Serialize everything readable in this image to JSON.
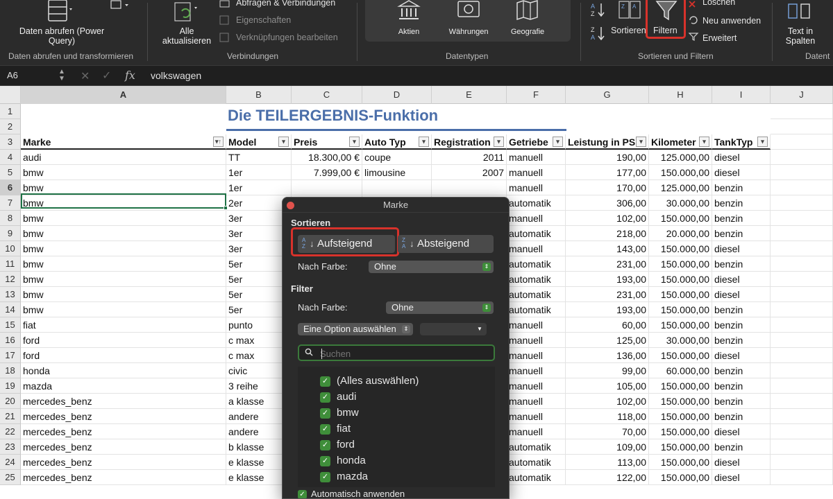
{
  "ribbon": {
    "groups": {
      "data_get": {
        "label": "Daten abrufen und transformieren",
        "button": "Daten abrufen (Power Query)"
      },
      "connections": {
        "label": "Verbindungen",
        "refresh_all": "Alle aktualisieren",
        "queries": "Abfragen & Verbindungen",
        "properties": "Eigenschaften",
        "edit_links": "Verknüpfungen bearbeiten"
      },
      "datatypes": {
        "label": "Datentypen",
        "items": [
          "Aktien",
          "Währungen",
          "Geografie"
        ]
      },
      "sort_filter": {
        "label": "Sortieren und Filtern",
        "sort": "Sortieren",
        "filter": "Filtern",
        "clear": "Löschen",
        "reapply": "Neu anwenden",
        "advanced": "Erweitert"
      },
      "data_tools": {
        "label": "Datent",
        "text_to_columns": "Text in Spalten"
      }
    }
  },
  "formula_bar": {
    "name_box": "A6",
    "value": "volkswagen",
    "fx": "fx"
  },
  "grid": {
    "columns": [
      "A",
      "B",
      "C",
      "D",
      "E",
      "F",
      "G",
      "H",
      "I",
      "J"
    ],
    "selected_column": "A",
    "selected_row": "6",
    "row_numbers": [
      "1",
      "2",
      "3",
      "4",
      "5",
      "6",
      "7",
      "8",
      "9",
      "10",
      "11",
      "12",
      "13",
      "14",
      "15",
      "16",
      "17",
      "18",
      "19",
      "20",
      "21",
      "22",
      "23",
      "24",
      "25"
    ],
    "title": "Die TEILERGEBNIS-Funktion",
    "headers": [
      "Marke",
      "Model",
      "Preis",
      "Auto Typ",
      "Registration",
      "Getriebe",
      "Leistung in PS",
      "Kilometer",
      "TankTyp"
    ],
    "rows": [
      [
        "audi",
        "TT",
        "18.300,00 €",
        "coupe",
        "2011",
        "manuell",
        "190,00",
        "125.000,00",
        "diesel"
      ],
      [
        "bmw",
        "1er",
        "7.999,00 €",
        "limousine",
        "2007",
        "manuell",
        "177,00",
        "150.000,00",
        "diesel"
      ],
      [
        "bmw",
        "1er",
        "",
        "",
        "",
        "manuell",
        "170,00",
        "125.000,00",
        "benzin"
      ],
      [
        "bmw",
        "2er",
        "",
        "",
        "",
        "automatik",
        "306,00",
        "30.000,00",
        "benzin"
      ],
      [
        "bmw",
        "3er",
        "",
        "",
        "",
        "manuell",
        "102,00",
        "150.000,00",
        "benzin"
      ],
      [
        "bmw",
        "3er",
        "",
        "",
        "",
        "automatik",
        "218,00",
        "20.000,00",
        "benzin"
      ],
      [
        "bmw",
        "3er",
        "",
        "",
        "",
        "manuell",
        "143,00",
        "150.000,00",
        "diesel"
      ],
      [
        "bmw",
        "5er",
        "",
        "",
        "",
        "automatik",
        "231,00",
        "150.000,00",
        "benzin"
      ],
      [
        "bmw",
        "5er",
        "",
        "",
        "",
        "automatik",
        "193,00",
        "150.000,00",
        "diesel"
      ],
      [
        "bmw",
        "5er",
        "",
        "",
        "",
        "automatik",
        "231,00",
        "150.000,00",
        "diesel"
      ],
      [
        "bmw",
        "5er",
        "",
        "",
        "",
        "automatik",
        "193,00",
        "150.000,00",
        "benzin"
      ],
      [
        "fiat",
        "punto",
        "",
        "",
        "",
        "manuell",
        "60,00",
        "150.000,00",
        "benzin"
      ],
      [
        "ford",
        "c max",
        "",
        "",
        "",
        "manuell",
        "125,00",
        "30.000,00",
        "benzin"
      ],
      [
        "ford",
        "c max",
        "",
        "",
        "",
        "manuell",
        "136,00",
        "150.000,00",
        "diesel"
      ],
      [
        "honda",
        "civic",
        "",
        "",
        "",
        "manuell",
        "99,00",
        "60.000,00",
        "benzin"
      ],
      [
        "mazda",
        "3 reihe",
        "",
        "",
        "",
        "manuell",
        "105,00",
        "150.000,00",
        "benzin"
      ],
      [
        "mercedes_benz",
        "a klasse",
        "",
        "",
        "",
        "manuell",
        "102,00",
        "150.000,00",
        "benzin"
      ],
      [
        "mercedes_benz",
        "andere",
        "",
        "",
        "",
        "manuell",
        "118,00",
        "150.000,00",
        "benzin"
      ],
      [
        "mercedes_benz",
        "andere",
        "",
        "",
        "",
        "manuell",
        "70,00",
        "150.000,00",
        "diesel"
      ],
      [
        "mercedes_benz",
        "b klasse",
        "",
        "",
        "",
        "automatik",
        "109,00",
        "150.000,00",
        "benzin"
      ],
      [
        "mercedes_benz",
        "e klasse",
        "",
        "",
        "",
        "automatik",
        "113,00",
        "150.000,00",
        "diesel"
      ],
      [
        "mercedes_benz",
        "e klasse",
        "",
        "",
        "",
        "automatik",
        "122,00",
        "150.000,00",
        "diesel"
      ]
    ]
  },
  "filter_popup": {
    "title": "Marke",
    "sort_label": "Sortieren",
    "ascending": "Aufsteigend",
    "descending": "Absteigend",
    "by_color_label": "Nach Farbe:",
    "sort_color_value": "Ohne",
    "filter_label": "Filter",
    "filter_color_value": "Ohne",
    "option_select": "Eine Option auswählen",
    "search_placeholder": "Suchen",
    "items": [
      "(Alles auswählen)",
      "audi",
      "bmw",
      "fiat",
      "ford",
      "honda",
      "mazda"
    ],
    "auto_apply": "Automatisch anwenden"
  },
  "colors": {
    "accent_green": "#3f8e3a",
    "highlight_red": "#d8322b",
    "title_blue": "#4a6ea9"
  }
}
